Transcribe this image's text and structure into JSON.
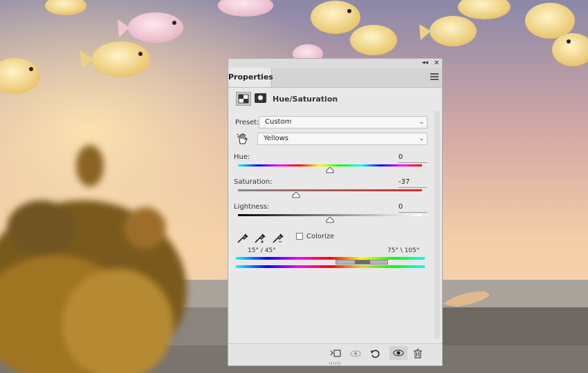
{
  "panel": {
    "tab": "Properties",
    "adjustment_title": "Hue/Saturation",
    "preset": {
      "label": "Preset:",
      "value": "Custom"
    },
    "channel": {
      "value": "Yellows"
    },
    "hue": {
      "label": "Hue:",
      "value": "0"
    },
    "saturation": {
      "label": "Saturation:",
      "value": "-37"
    },
    "lightness": {
      "label": "Lightness:",
      "value": "0"
    },
    "colorize": {
      "label": "Colorize",
      "checked": false
    },
    "range_left": "15° / 45°",
    "range_right": "75° \\ 105°"
  },
  "colors": {
    "panel_bg": "#e8e8e8",
    "sky_top": "#8f8aa8",
    "sky_bottom": "#f1c9a6",
    "wall": "#8c8680"
  },
  "icons": {
    "collapse": "double-chevron-left-icon",
    "close": "close-icon",
    "menu": "hamburger-menu-icon",
    "hand": "targeted-adjustment-hand-icon",
    "eyedroppers": [
      "eyedropper-icon",
      "eyedropper-add-icon",
      "eyedropper-subtract-icon"
    ],
    "bottom": [
      "clip-to-layer-icon",
      "view-previous-state-icon",
      "reset-icon",
      "visibility-eye-icon",
      "trash-icon"
    ]
  }
}
